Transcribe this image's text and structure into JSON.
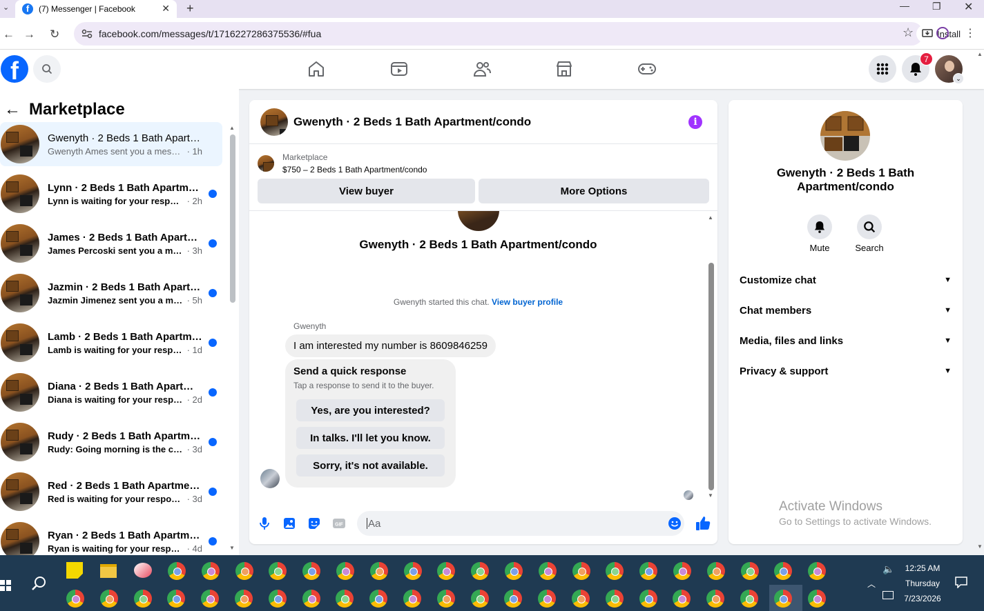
{
  "browser": {
    "tab_title": "(7) Messenger | Facebook",
    "url": "facebook.com/messages/t/1716227286375536/#fua",
    "install_label": "Install"
  },
  "fb_header": {
    "logo": "f",
    "notification_count": "7",
    "nav_icons": [
      "home-icon",
      "video-icon",
      "friends-icon",
      "marketplace-icon",
      "gaming-icon"
    ]
  },
  "sidebar": {
    "title": "Marketplace",
    "conversations": [
      {
        "name": "Gwenyth · 2 Beds 1 Bath Apartm...",
        "preview": "Gwenyth Ames sent you a message...",
        "time": "1h",
        "unread": false,
        "active": true
      },
      {
        "name": "Lynn · 2 Beds 1 Bath Apartmen...",
        "preview": "Lynn is waiting for your response.",
        "time": "2h",
        "unread": true
      },
      {
        "name": "James · 2 Beds 1 Bath Apartme...",
        "preview": "James Percoski sent you a mess...",
        "time": "3h",
        "unread": true
      },
      {
        "name": "Jazmin · 2 Beds 1 Bath Apartm...",
        "preview": "Jazmin Jimenez sent you a mess...",
        "time": "5h",
        "unread": true
      },
      {
        "name": "Lamb · 2 Beds 1 Bath Apartme...",
        "preview": "Lamb is waiting for your respon...",
        "time": "1d",
        "unread": true
      },
      {
        "name": "Diana · 2 Beds 1 Bath Apartme...",
        "preview": "Diana is waiting for your respon...",
        "time": "2d",
        "unread": true
      },
      {
        "name": "Rudy · 2 Beds 1 Bath Apartme...",
        "preview": "Rudy: Going morning is the con...",
        "time": "3d",
        "unread": true
      },
      {
        "name": "Red · 2 Beds 1 Bath Apartment...",
        "preview": "Red is waiting for your response.",
        "time": "3d",
        "unread": true
      },
      {
        "name": "Ryan · 2 Beds 1 Bath Apartmen...",
        "preview": "Ryan is waiting for your response.",
        "time": "4d",
        "unread": true
      }
    ]
  },
  "chat": {
    "title": "Gwenyth · 2 Beds 1 Bath Apartment/condo",
    "marketplace_label": "Marketplace",
    "listing": "$750 – 2 Beds 1 Bath Apartment/condo",
    "view_buyer": "View buyer",
    "more_options": "More Options",
    "intro_title": "Gwenyth · 2 Beds 1 Bath Apartment/condo",
    "started_text": "Gwenyth started this chat.",
    "view_profile": "View buyer profile",
    "sender": "Gwenyth",
    "message": "I am interested my number is 8609846259",
    "quick_title": "Send a quick response",
    "quick_sub": "Tap a response to send it to the buyer.",
    "quick_replies": [
      "Yes, are you interested?",
      "In talks. I'll let you know.",
      "Sorry, it's not available."
    ],
    "input_placeholder": "Aa"
  },
  "details": {
    "name": "Gwenyth · 2 Beds 1 Bath Apartment/condo",
    "mute": "Mute",
    "search": "Search",
    "sections": [
      "Customize chat",
      "Chat members",
      "Media, files and links",
      "Privacy & support"
    ]
  },
  "watermark": {
    "line1": "Activate Windows",
    "line2": "Go to Settings to activate Windows."
  },
  "taskbar": {
    "time": "12:25 AM",
    "day": "Thursday",
    "date": "7/23/2026"
  },
  "colors": {
    "brand_blue": "#0866ff",
    "info_purple": "#a033ff",
    "notification_red": "#e41e3f",
    "taskbar": "#1f3a52"
  }
}
